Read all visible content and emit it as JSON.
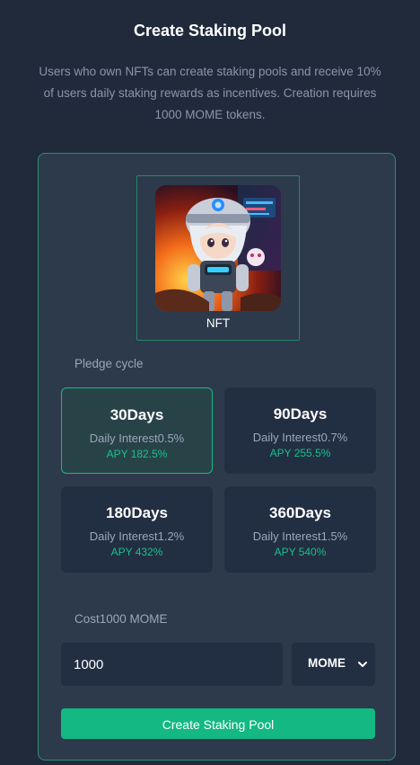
{
  "header": {
    "title": "Create Staking Pool",
    "description": "Users who own NFTs can create staking pools and receive 10% of users daily staking rewards as incentives. Creation requires 1000 MOME tokens."
  },
  "nft": {
    "label": "NFT",
    "image_icon": "nft-character-image"
  },
  "pledge": {
    "label": "Pledge cycle",
    "selected_index": 0,
    "options": [
      {
        "days": "30Days",
        "interest": "Daily Interest0.5%",
        "apy": "APY 182.5%"
      },
      {
        "days": "90Days",
        "interest": "Daily Interest0.7%",
        "apy": "APY 255.5%"
      },
      {
        "days": "180Days",
        "interest": "Daily Interest1.2%",
        "apy": "APY 432%"
      },
      {
        "days": "360Days",
        "interest": "Daily Interest1.5%",
        "apy": "APY 540%"
      }
    ]
  },
  "cost": {
    "label": "Cost1000 MOME",
    "amount_value": "1000",
    "token_selected": "MOME",
    "token_icon": "chevron-down-icon"
  },
  "actions": {
    "create_label": "Create Staking Pool"
  },
  "colors": {
    "background": "#202a3b",
    "card": "#2d3a4c",
    "accent": "#13b882",
    "apy_text": "#19c08a"
  }
}
